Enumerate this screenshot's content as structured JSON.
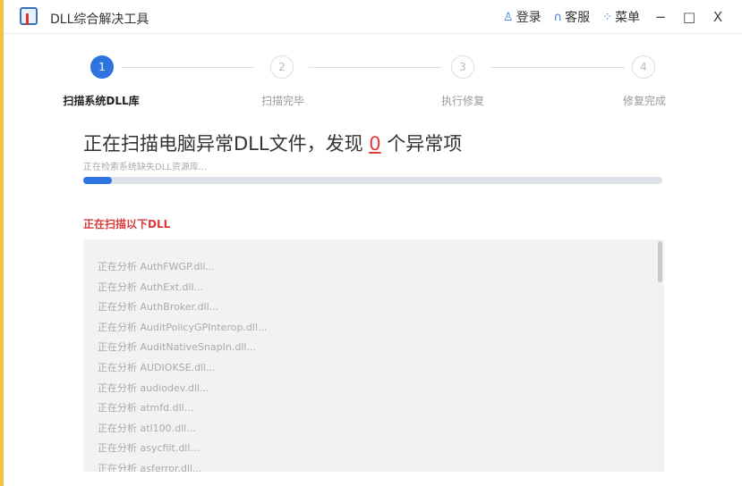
{
  "window": {
    "title": "DLL综合解决工具",
    "login": "登录",
    "service": "客服",
    "menu": "菜单",
    "minimize": "−",
    "maximize": "□",
    "close": "X"
  },
  "steps": [
    {
      "num": "1",
      "label": "扫描系统DLL库",
      "active": true
    },
    {
      "num": "2",
      "label": "扫描完毕",
      "active": false
    },
    {
      "num": "3",
      "label": "执行修复",
      "active": false
    },
    {
      "num": "4",
      "label": "修复完成",
      "active": false
    }
  ],
  "scan": {
    "heading_pre": "正在扫描电脑异常DLL文件，发现 ",
    "count": "0",
    "heading_post": " 个异常项",
    "subtext": "正在检索系统缺失DLL资源库...",
    "progress_percent": 5,
    "list_title": "正在扫描以下DLL"
  },
  "items": [
    "正在分析 AuthFWGP.dll...",
    "正在分析 AuthExt.dll...",
    "正在分析 AuthBroker.dll...",
    "正在分析 AuditPolicyGPInterop.dll...",
    "正在分析 AuditNativeSnapIn.dll...",
    "正在分析 AUDIOKSE.dll...",
    "正在分析 audiodev.dll...",
    "正在分析 atmfd.dll...",
    "正在分析 atl100.dll...",
    "正在分析 asycfilt.dll...",
    "正在分析 asferror.dll..."
  ],
  "colors": {
    "accent": "#2d74de",
    "alert": "#d83b3b"
  }
}
